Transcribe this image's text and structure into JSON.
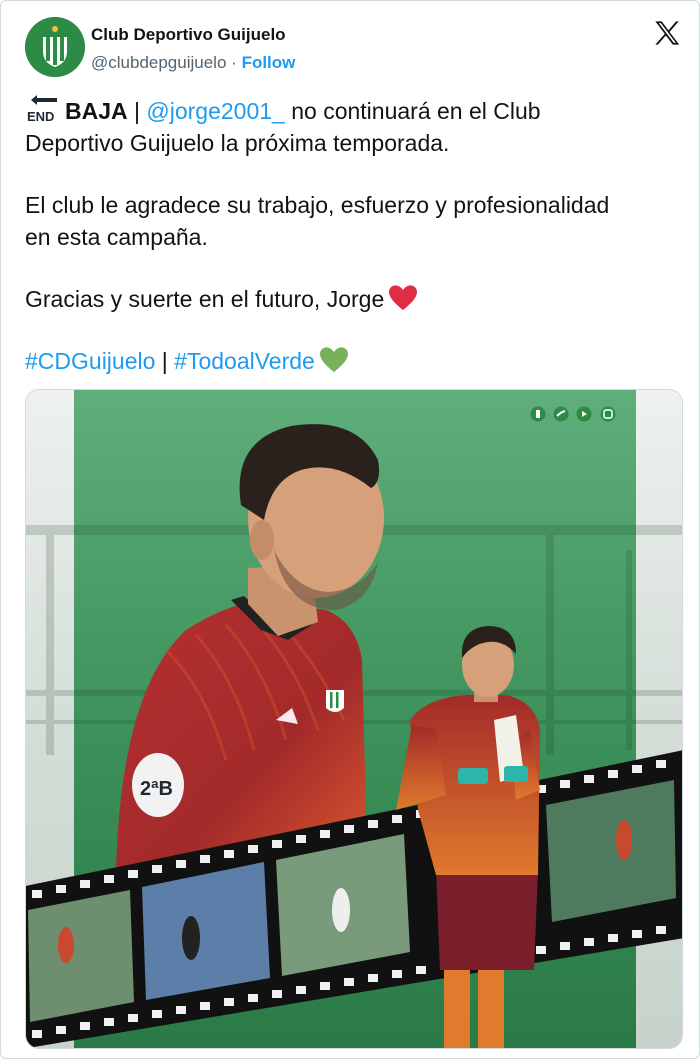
{
  "account": {
    "name": "Club Deportivo Guijuelo",
    "handle": "@clubdepguijuelo",
    "separator": "·",
    "follow_label": "Follow"
  },
  "tweet": {
    "line1_bold": "BAJA",
    "line1_pipe": " | ",
    "line1_mention": "@jorge2001_",
    "line1_rest": " no continuará en el Club",
    "line2": "Deportivo Guijuelo la próxima temporada.",
    "para2_line1": "El club le agradece su trabajo, esfuerzo y profesionalidad",
    "para2_line2": "en esta campaña.",
    "para3": "Gracias y suerte en el futuro, Jorge",
    "hashtag1": "#CDGuijuelo",
    "hashtag_sep": " | ",
    "hashtag2": "#TodoalVerde"
  },
  "icons": {
    "end_arrow": "end-arrow-icon",
    "heart_red": "red-heart-icon",
    "heart_green": "green-heart-icon",
    "x_logo": "x-logo-icon"
  },
  "media": {
    "end_label": "END",
    "shirt_badge": "2ªB"
  },
  "colors": {
    "link": "#1d9bf0",
    "club_green": "#2e8b45",
    "shirt_red": "#a32a2a",
    "text": "#0f1419",
    "muted": "#536471"
  }
}
